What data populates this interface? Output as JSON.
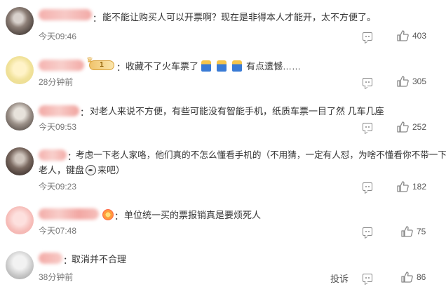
{
  "comments": [
    {
      "text": "能不能让购买人可以开票啊？现在是非得本人才能开，太不方便了。",
      "time": "今天09:46",
      "likes": "403"
    },
    {
      "text_before": "收藏不了火车票了",
      "text_after": "有点遗憾……",
      "badge_level": "1",
      "time": "28分钟前",
      "likes": "305"
    },
    {
      "text": "对老人来说不方便，有些可能没有智能手机，纸质车票一目了然 几车几座",
      "time": "今天09:53",
      "likes": "252"
    },
    {
      "text_line1": "考虑一下老人家咯，他们真的不怎么懂看手机的（不用猜，一定有人怼，为啥不懂看你不带一下",
      "text_line2_before": "老人，键盘",
      "text_line2_after": "来吧）",
      "time": "今天09:23",
      "likes": "182"
    },
    {
      "text": "单位统一买的票报销真是要烦死人",
      "time": "今天07:48",
      "likes": "75"
    },
    {
      "text": "取消并不合理",
      "time": "38分钟前",
      "likes": "86",
      "report_label": "投诉"
    }
  ],
  "colon": "："
}
